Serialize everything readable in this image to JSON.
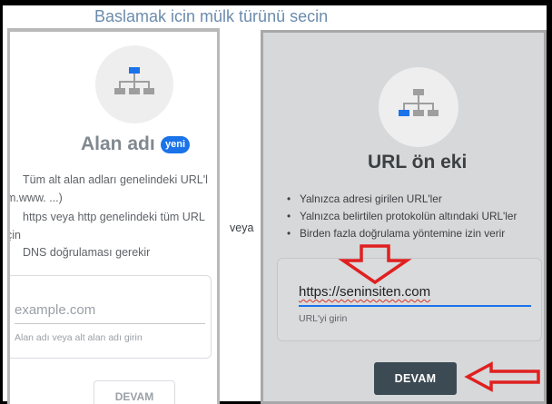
{
  "heading": "Baslamak icin mülk türünü secin",
  "separator": "veya",
  "domain_card": {
    "title": "Alan adı",
    "badge": "yeni",
    "features": [
      "Tüm alt alan adları genelindeki URL'l",
      "m.www. ...)",
      "https veya http genelindeki tüm URL",
      "çin",
      "DNS doğrulaması gerekir"
    ],
    "input_placeholder": "example.com",
    "input_helper": "Alan adı veya alt alan adı girin",
    "button_label": "DEVAM"
  },
  "url_card": {
    "title": "URL ön eki",
    "features": [
      "Yalnızca adresi girilen URL'ler",
      "Yalnızca belirtilen protokolün altındaki URL'ler",
      "Birden fazla doğrulama yöntemine izin verir"
    ],
    "input_value": "https://seninsiten.com",
    "input_helper": "URL'yi girin",
    "button_label": "DEVAM"
  },
  "colors": {
    "accent_blue": "#1a73e8",
    "annotation_red": "#e02020",
    "button_dark": "#3c4a53",
    "selected_card_bg": "#d6d8da"
  },
  "icons": {
    "domain_card_icon": "sitemap-icon",
    "url_card_icon": "sitemap-icon",
    "annotation_down": "arrow-down-icon",
    "annotation_left": "arrow-left-icon"
  }
}
